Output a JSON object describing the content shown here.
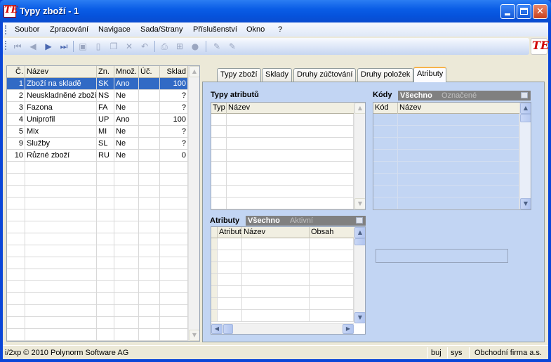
{
  "window": {
    "title": "Typy zboží - 1",
    "logo_text": "TE"
  },
  "menu": [
    "Soubor",
    "Zpracování",
    "Navigace",
    "Sada/Strany",
    "Příslušenství",
    "Okno",
    "?"
  ],
  "toolbar_icons": [
    "first-record-icon",
    "prev-record-icon",
    "next-record-icon",
    "last-record-icon",
    "save-icon",
    "new-icon",
    "copy-icon",
    "delete-icon",
    "undo-icon",
    "print-icon",
    "tree-icon",
    "refresh-icon",
    "edit-icon",
    "edit-alt-icon"
  ],
  "item_grid": {
    "columns": [
      "Č.",
      "Název",
      "Zn.",
      "Množ.",
      "Úč.",
      "Sklad"
    ],
    "rows": [
      {
        "no": "1",
        "name": "Zboží na skladě",
        "code": "SK",
        "qty": "Ano",
        "acc": "",
        "stock": "100"
      },
      {
        "no": "2",
        "name": "Neuskladněné zboží",
        "code": "NS",
        "qty": "Ne",
        "acc": "",
        "stock": "?"
      },
      {
        "no": "3",
        "name": "Fazona",
        "code": "FA",
        "qty": "Ne",
        "acc": "",
        "stock": "?"
      },
      {
        "no": "4",
        "name": "Uniprofil",
        "code": "UP",
        "qty": "Ano",
        "acc": "",
        "stock": "100"
      },
      {
        "no": "5",
        "name": "Mix",
        "code": "MI",
        "qty": "Ne",
        "acc": "",
        "stock": "?"
      },
      {
        "no": "9",
        "name": "Služby",
        "code": "SL",
        "qty": "Ne",
        "acc": "",
        "stock": "?"
      },
      {
        "no": "10",
        "name": "Různé zboží",
        "code": "RU",
        "qty": "Ne",
        "acc": "",
        "stock": "0"
      }
    ],
    "selected_index": 0
  },
  "tabs": [
    "Typy zboží",
    "Sklady",
    "Druhy zúčtování",
    "Druhy položek",
    "Atributy"
  ],
  "active_tab": "Atributy",
  "attr_types": {
    "label": "Typy atributů",
    "columns": [
      "Typ",
      "Název"
    ]
  },
  "codes": {
    "label": "Kódy",
    "filter_on": "Všechno",
    "filter_off": "Označené",
    "columns": [
      "Kód",
      "Název"
    ]
  },
  "attributes": {
    "label": "Atributy",
    "filter_on": "Všechno",
    "filter_off": "Aktivní",
    "columns": [
      "Atribut",
      "Název",
      "Obsah"
    ]
  },
  "status": {
    "copyright": "i/2xp © 2010 Polynorm Software AG",
    "user": "buj",
    "db": "sys",
    "company": "Obchodní firma a.s."
  },
  "colors": {
    "selection": "#316ac5",
    "panel": "#c2d5f3",
    "title": "#0a5de6"
  }
}
